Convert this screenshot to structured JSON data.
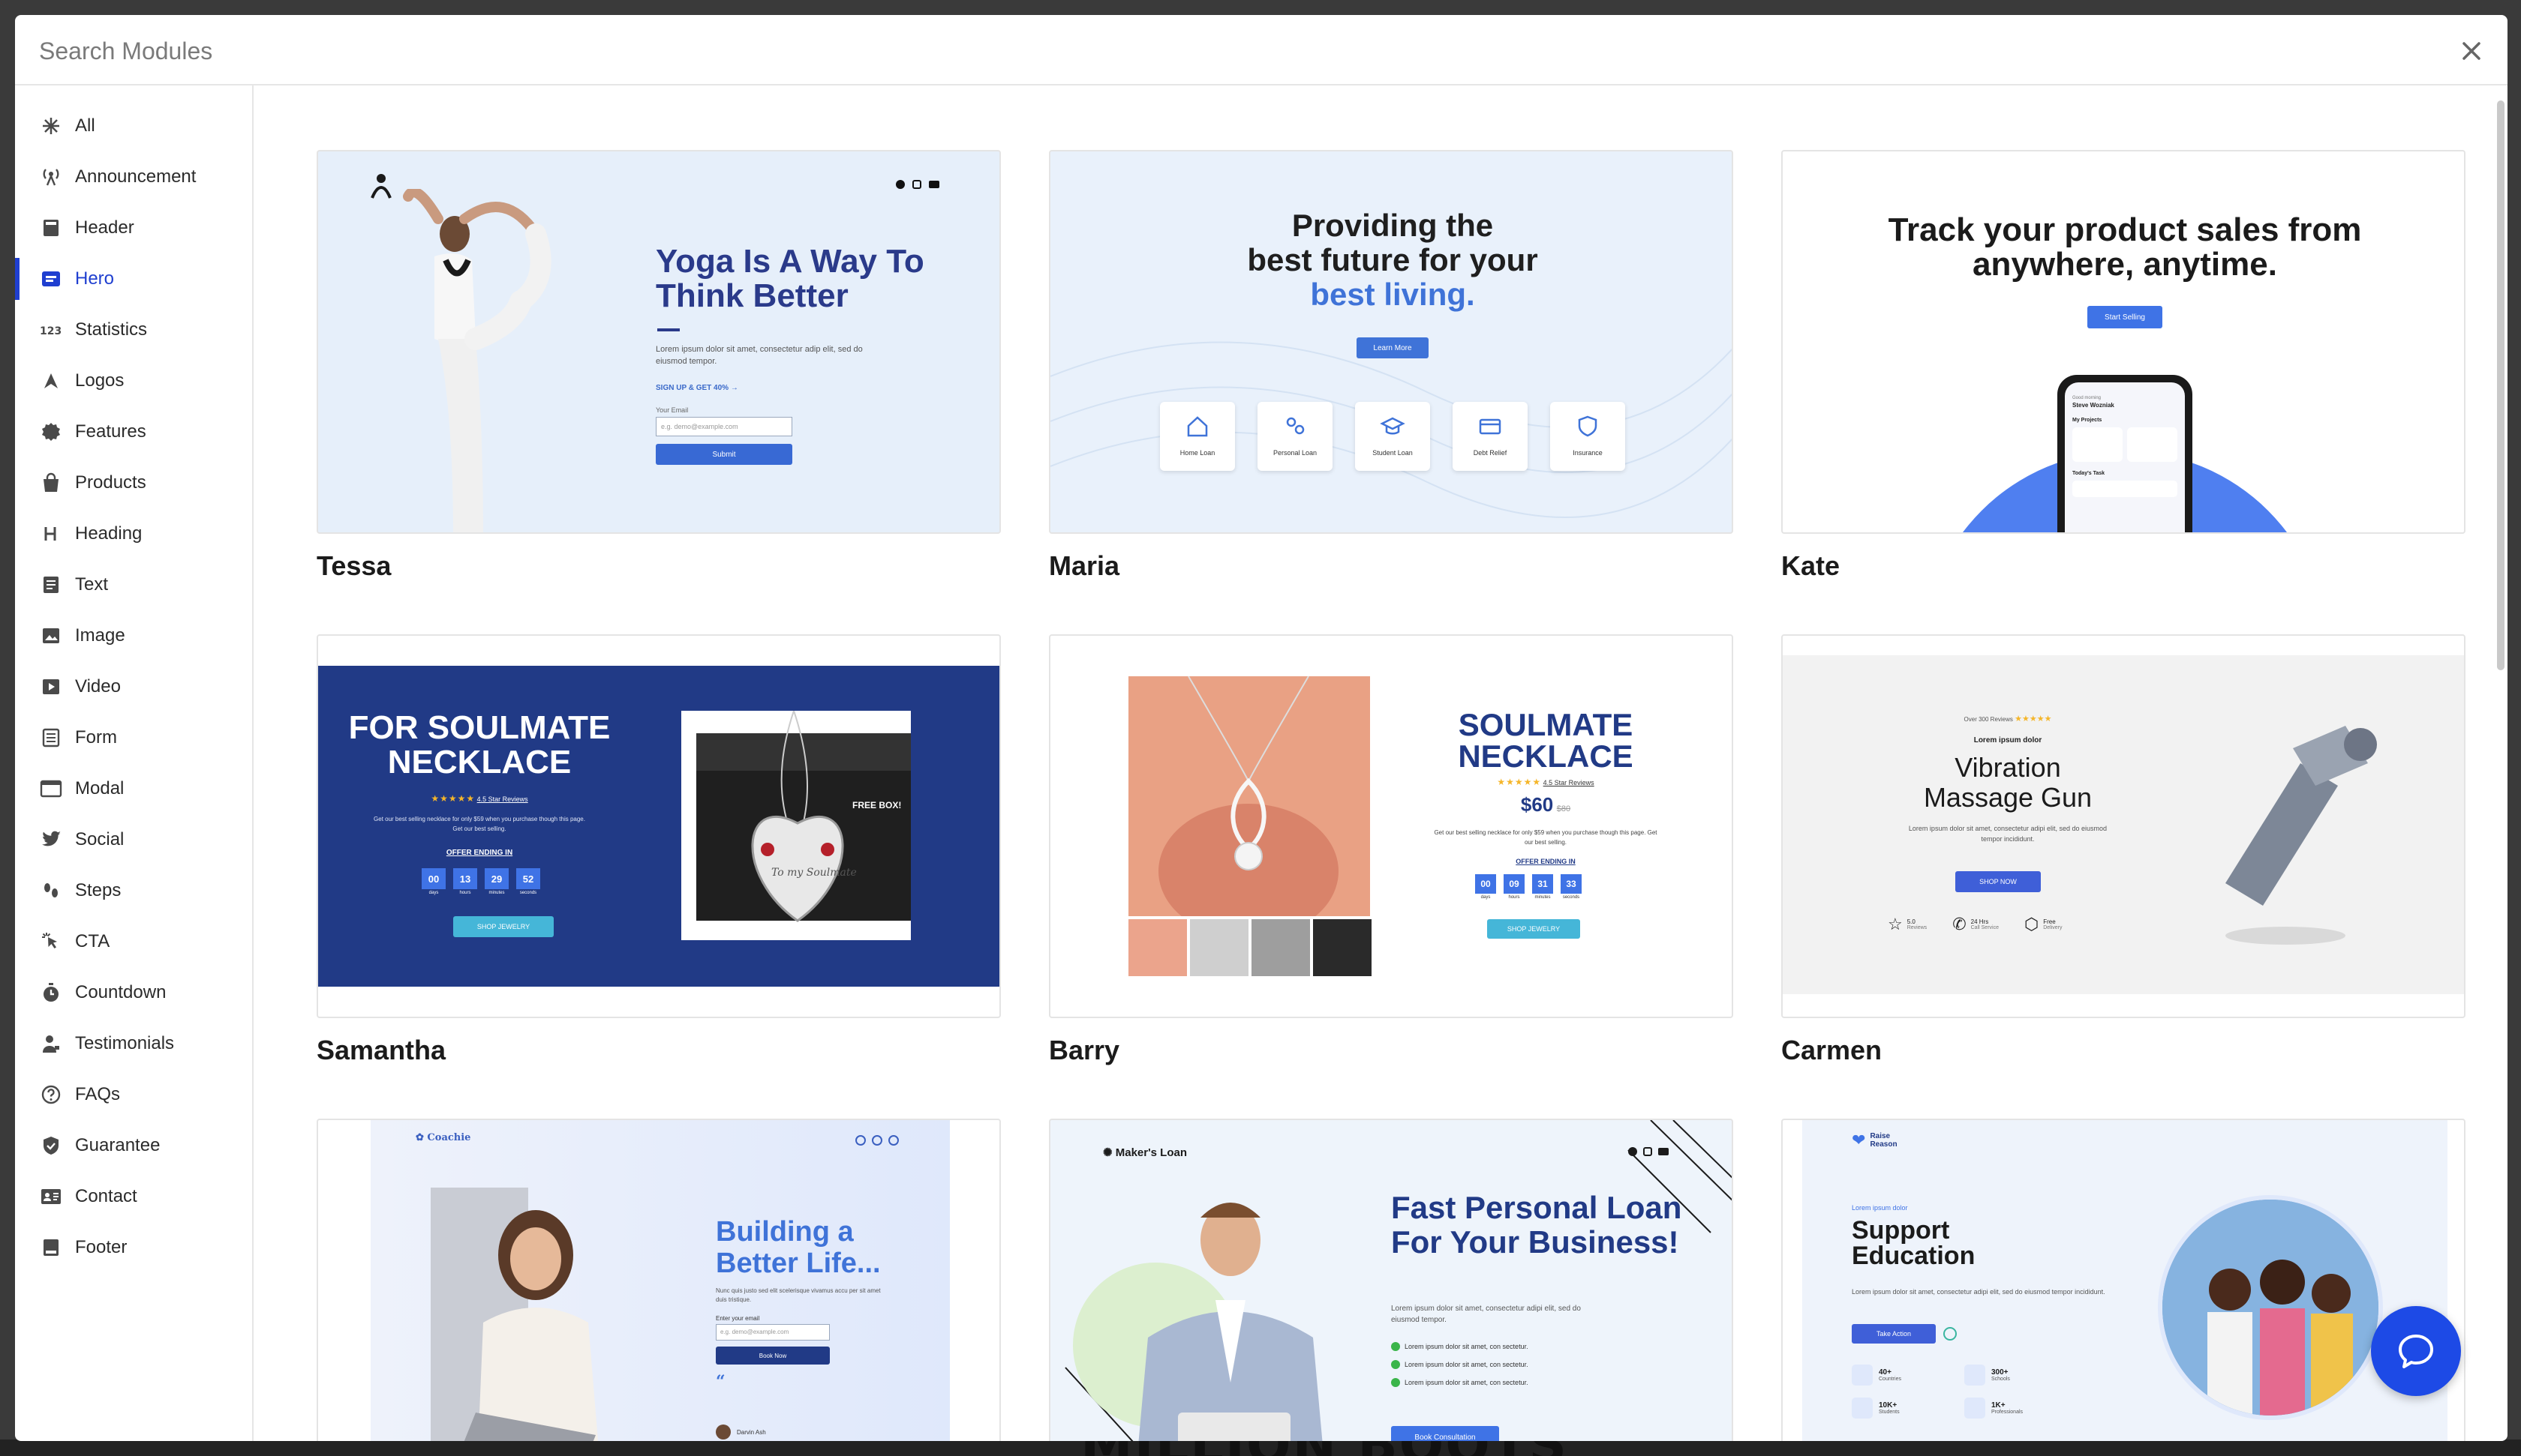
{
  "search": {
    "placeholder": "Search Modules"
  },
  "sidebar": {
    "items": [
      {
        "label": "All",
        "icon": "asterisk-icon"
      },
      {
        "label": "Announcement",
        "icon": "broadcast-icon"
      },
      {
        "label": "Header",
        "icon": "header-icon"
      },
      {
        "label": "Hero",
        "icon": "hero-icon",
        "active": true
      },
      {
        "label": "Statistics",
        "icon": "numbers-icon"
      },
      {
        "label": "Logos",
        "icon": "logo-icon"
      },
      {
        "label": "Features",
        "icon": "gear-icon"
      },
      {
        "label": "Products",
        "icon": "shopping-bag-icon"
      },
      {
        "label": "Heading",
        "icon": "heading-icon"
      },
      {
        "label": "Text",
        "icon": "text-icon"
      },
      {
        "label": "Image",
        "icon": "image-icon"
      },
      {
        "label": "Video",
        "icon": "video-icon"
      },
      {
        "label": "Form",
        "icon": "form-icon"
      },
      {
        "label": "Modal",
        "icon": "modal-icon"
      },
      {
        "label": "Social",
        "icon": "twitter-icon"
      },
      {
        "label": "Steps",
        "icon": "steps-icon"
      },
      {
        "label": "CTA",
        "icon": "cursor-click-icon"
      },
      {
        "label": "Countdown",
        "icon": "stopwatch-icon"
      },
      {
        "label": "Testimonials",
        "icon": "person-quote-icon"
      },
      {
        "label": "FAQs",
        "icon": "question-icon"
      },
      {
        "label": "Guarantee",
        "icon": "shield-icon"
      },
      {
        "label": "Contact",
        "icon": "contact-card-icon"
      },
      {
        "label": "Footer",
        "icon": "footer-icon"
      }
    ]
  },
  "cards": [
    {
      "name": "Tessa",
      "heading": "Yoga Is A Way To Think Better",
      "body": "Lorem ipsum dolor sit amet, consectetur adip elit, sed do eiusmod tempor.",
      "link": "SIGN UP & GET 40% →",
      "email_label": "Your Email",
      "email_placeholder": "e.g. demo@example.com",
      "submit": "Submit"
    },
    {
      "name": "Maria",
      "heading_1": "Providing the",
      "heading_2": "best future for your",
      "heading_accent": "best living.",
      "button": "Learn More",
      "tiles": [
        "Home Loan",
        "Personal Loan",
        "Student Loan",
        "Debt Relief",
        "Insurance"
      ]
    },
    {
      "name": "Kate",
      "heading": "Track your product sales from anywhere, anytime.",
      "button": "Start Selling",
      "phone_greeting": "Good morning",
      "phone_user": "Steve Wozniak",
      "phone_projects": "My Projects",
      "phone_tasks": "Today's Task"
    },
    {
      "name": "Samantha",
      "heading": "FOR SOULMATE NECKLACE",
      "reviews": "4.5 Star Reviews",
      "body": "Get our best selling necklace for only $59 when you purchase though this page. Get our best selling.",
      "offer": "OFFER ENDING IN",
      "timer": [
        "00",
        "13",
        "29",
        "52"
      ],
      "timer_units": [
        "days",
        "hours",
        "minutes",
        "seconds"
      ],
      "button": "SHOP JEWELRY",
      "box_label": "FREE BOX!",
      "heart_text": "To my Soulmate"
    },
    {
      "name": "Barry",
      "heading": "SOULMATE NECKLACE",
      "reviews": "4.5 Star Reviews",
      "price": "$60",
      "old_price": "$80",
      "body": "Get our best selling necklace for only $59 when you purchase though this page. Get our best selling.",
      "offer": "OFFER ENDING IN",
      "timer": [
        "00",
        "09",
        "31",
        "33"
      ],
      "timer_units": [
        "days",
        "hours",
        "minutes",
        "seconds"
      ],
      "button": "SHOP JEWELRY"
    },
    {
      "name": "Carmen",
      "reviews": "Over 300 Reviews",
      "kicker": "Lorem ipsum dolor",
      "heading_1": "Vibration",
      "heading_2": "Massage Gun",
      "body": "Lorem ipsum dolor sit amet, consectetur adipi elit, sed do eiusmod tempor incididunt.",
      "button": "SHOP NOW",
      "features": [
        {
          "value": "5.0",
          "label": "Reviews"
        },
        {
          "value": "24 Hrs",
          "label": "Call Service"
        },
        {
          "value": "Free",
          "label": "Delivery"
        }
      ]
    },
    {
      "name": "",
      "logo": "Coachie",
      "heading": "Building a Better Life...",
      "body": "Nunc quis justo sed elit scelerisque vivamus accu per sit amet duis tristique.",
      "email_label": "Enter your email",
      "email_placeholder": "e.g. demo@example.com",
      "button": "Book Now",
      "author": "Darvin Ash"
    },
    {
      "name": "",
      "logo": "Maker's Loan",
      "heading": "Fast Personal Loan For Your Business!",
      "body": "Lorem ipsum dolor sit amet, consectetur adipi elit, sed do eiusmod tempor.",
      "checks": [
        "Lorem ipsum dolor sit amet, con sectetur.",
        "Lorem ipsum dolor sit amet, con sectetur.",
        "Lorem ipsum dolor sit amet, con sectetur."
      ],
      "button": "Book Consultation"
    },
    {
      "name": "",
      "logo_1": "Raise",
      "logo_2": "Reason",
      "kicker": "Lorem ipsum dolor",
      "heading": "Support Education",
      "body": "Lorem ipsum dolor sit amet, consectetur adipi elit, sed do eiusmod tempor incididunt.",
      "button": "Take Action",
      "stats": [
        {
          "value": "40+",
          "label": "Countries"
        },
        {
          "value": "300+",
          "label": "Schools"
        },
        {
          "value": "10K+",
          "label": "Students"
        },
        {
          "value": "1K+",
          "label": "Professionals"
        }
      ]
    }
  ],
  "backdrop": {
    "text": "MILLION BOOTS"
  },
  "colors": {
    "accent": "#1f3fd0",
    "help_button": "#1d4ae6"
  }
}
